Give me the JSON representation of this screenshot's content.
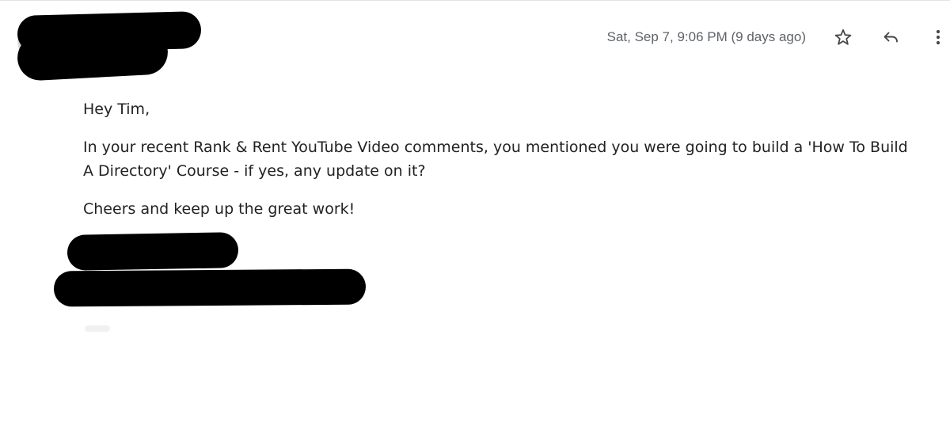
{
  "header": {
    "timestamp": "Sat, Sep 7, 9:06 PM (9 days ago)"
  },
  "icons": {
    "star": "star-icon",
    "reply": "reply-icon",
    "more": "more-vert-icon"
  },
  "message": {
    "greeting": "Hey Tim,",
    "paragraph": "In your recent Rank & Rent YouTube Video comments, you mentioned you were going to build a 'How To Build A Directory' Course - if yes, any update on it?",
    "closing": "Cheers and keep up the great work!"
  }
}
